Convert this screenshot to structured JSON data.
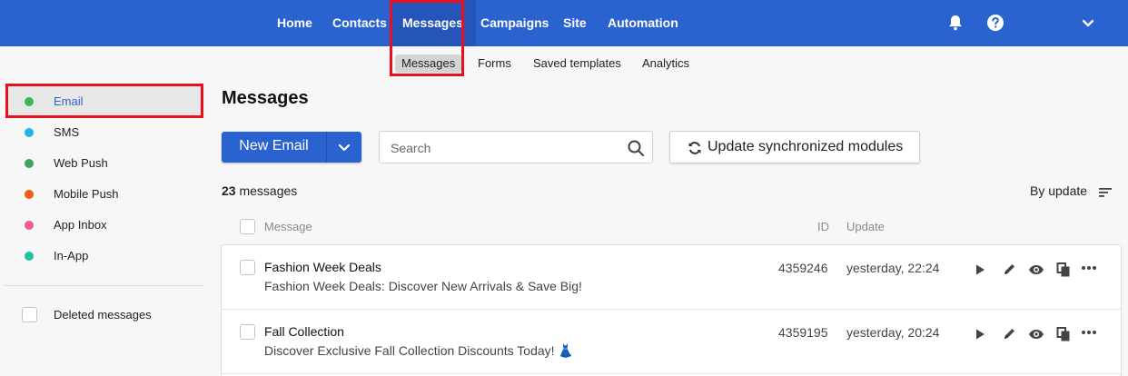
{
  "topnav": {
    "items": [
      "Home",
      "Contacts",
      "Messages",
      "Campaigns",
      "Site",
      "Automation"
    ],
    "active": "Messages",
    "icons": [
      "bell-icon",
      "help-icon",
      "chevron-down-icon"
    ],
    "color": "#2a62cf"
  },
  "subnav": {
    "items": [
      "Messages",
      "Forms",
      "Saved templates",
      "Analytics"
    ],
    "active": "Messages"
  },
  "sidebar": {
    "channels": [
      {
        "label": "Email",
        "color": "#3fb55a"
      },
      {
        "label": "SMS",
        "color": "#23b5ea"
      },
      {
        "label": "Web Push",
        "color": "#3fa55e"
      },
      {
        "label": "Mobile Push",
        "color": "#ef5a16"
      },
      {
        "label": "App Inbox",
        "color": "#f35d8a"
      },
      {
        "label": "In-App",
        "color": "#21bfa3"
      }
    ],
    "deleted_label": "Deleted messages"
  },
  "main": {
    "title": "Messages",
    "new_button": "New Email",
    "search_placeholder": "Search",
    "sync_button": "Update synchronized modules",
    "count_number": "23",
    "count_suffix": " messages",
    "sort_label": "By update",
    "columns": {
      "message": "Message",
      "id": "ID",
      "update": "Update"
    }
  },
  "messages": [
    {
      "title": "Fashion Week Deals",
      "description": "Fashion Week Deals: Discover New Arrivals & Save Big!",
      "id": "4359246",
      "updated": "yesterday, 22:24"
    },
    {
      "title": "Fall Collection",
      "description": "Discover Exclusive Fall Collection Discounts Today! 👗",
      "id": "4359195",
      "updated": "yesterday, 20:24"
    }
  ],
  "row_actions": [
    "play-icon",
    "edit-icon",
    "preview-icon",
    "copy-icon",
    "more-icon"
  ],
  "highlight_color": "#e8101f"
}
